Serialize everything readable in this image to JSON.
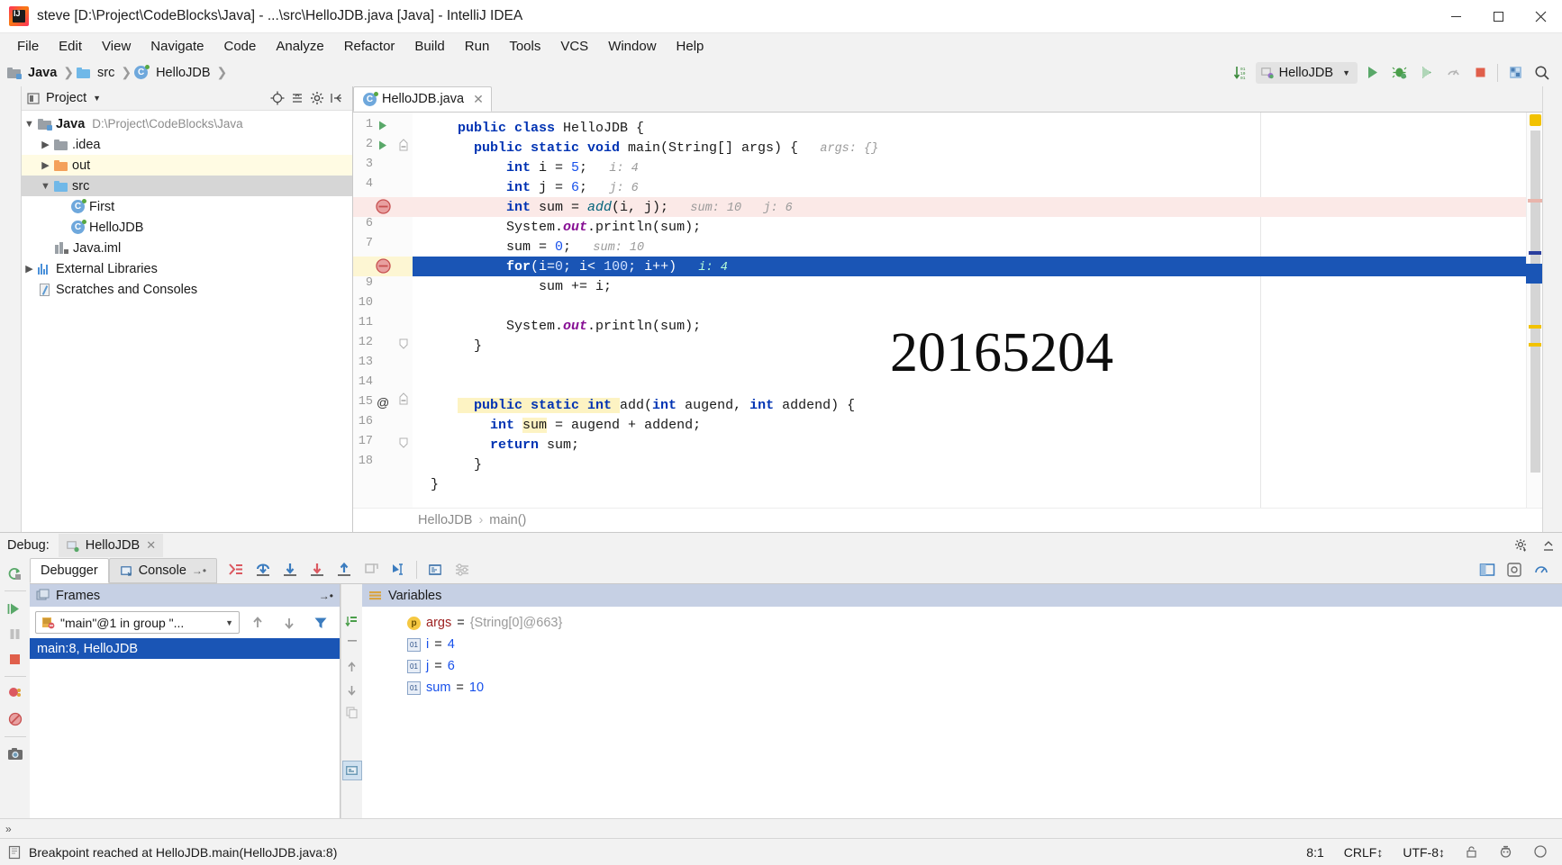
{
  "window": {
    "title": "steve [D:\\Project\\CodeBlocks\\Java] - ...\\src\\HelloJDB.java [Java] - IntelliJ IDEA",
    "minimize": "—",
    "maximize": "□",
    "close": "✕"
  },
  "menu": [
    "File",
    "Edit",
    "View",
    "Navigate",
    "Code",
    "Analyze",
    "Refactor",
    "Build",
    "Run",
    "Tools",
    "VCS",
    "Window",
    "Help"
  ],
  "breadcrumb_nav": [
    {
      "label": "Java",
      "icon": "module-icon",
      "bold": true
    },
    {
      "label": "src",
      "icon": "folder-blue-icon",
      "bold": false
    },
    {
      "label": "HelloJDB",
      "icon": "class-icon",
      "bold": false
    }
  ],
  "toolbar": {
    "run_config": "HelloJDB",
    "icons": [
      "sort-lines-icon",
      "run-icon",
      "debug-icon",
      "coverage-icon",
      "profiler-icon",
      "stop-icon",
      "build-project-icon",
      "search-everywhere-icon"
    ]
  },
  "project_panel": {
    "title": "Project",
    "header_icons": [
      "locate-icon",
      "collapse-all-icon",
      "gear-icon",
      "hide-icon"
    ],
    "tree": [
      {
        "indent": 0,
        "arrow": "down",
        "icon": "module-icon",
        "label": "Java",
        "bold": true,
        "path": "D:\\Project\\CodeBlocks\\Java",
        "highlight": "none"
      },
      {
        "indent": 1,
        "arrow": "right",
        "icon": "folder-grey-icon",
        "label": ".idea",
        "bold": false,
        "path": "",
        "highlight": "none"
      },
      {
        "indent": 1,
        "arrow": "right",
        "icon": "folder-orange-icon",
        "label": "out",
        "bold": false,
        "path": "",
        "highlight": "yellow"
      },
      {
        "indent": 1,
        "arrow": "down",
        "icon": "folder-blue-icon",
        "label": "src",
        "bold": false,
        "path": "",
        "highlight": "grey"
      },
      {
        "indent": 2,
        "arrow": "none",
        "icon": "class-icon",
        "label": "First",
        "bold": false,
        "path": "",
        "highlight": "none"
      },
      {
        "indent": 2,
        "arrow": "none",
        "icon": "class-icon",
        "label": "HelloJDB",
        "bold": false,
        "path": "",
        "highlight": "none"
      },
      {
        "indent": 1,
        "arrow": "none",
        "icon": "iml-file-icon",
        "label": "Java.iml",
        "bold": false,
        "path": "",
        "highlight": "none"
      },
      {
        "indent": 0,
        "arrow": "right",
        "icon": "library-icon",
        "label": "External Libraries",
        "bold": false,
        "path": "",
        "highlight": "none"
      },
      {
        "indent": 0,
        "arrow": "none",
        "icon": "scratch-icon",
        "label": "Scratches and Consoles",
        "bold": false,
        "path": "",
        "highlight": "none"
      }
    ]
  },
  "editor": {
    "tab": {
      "label": "HelloJDB.java",
      "icon": "java-class-icon",
      "close": "✕"
    },
    "watermark": "20165204",
    "breadcrumb": {
      "class": "HelloJDB",
      "sep": "›",
      "method": "main()"
    },
    "lines": [
      {
        "n": 1,
        "gutter": "run-arrow",
        "state": "normal",
        "tokens": [
          {
            "t": "    ",
            "c": "plain"
          },
          {
            "t": "public class ",
            "c": "kw"
          },
          {
            "t": "HelloJDB {",
            "c": "plain"
          }
        ]
      },
      {
        "n": 2,
        "gutter": "run-arrow-fold",
        "state": "normal",
        "tokens": [
          {
            "t": "    ",
            "c": "plain"
          },
          {
            "t": "public static void ",
            "c": "kw"
          },
          {
            "t": "main(String[] args) {",
            "c": "plain"
          },
          {
            "t": "   args: {}",
            "c": "hint"
          }
        ]
      },
      {
        "n": 3,
        "gutter": "",
        "state": "normal",
        "tokens": [
          {
            "t": "        ",
            "c": "plain"
          },
          {
            "t": "int",
            "c": "kw"
          },
          {
            "t": " i = ",
            "c": "plain"
          },
          {
            "t": "5",
            "c": "num"
          },
          {
            "t": ";",
            "c": "plain"
          },
          {
            "t": "   i: 4",
            "c": "hint"
          }
        ]
      },
      {
        "n": 4,
        "gutter": "",
        "state": "normal",
        "tokens": [
          {
            "t": "        ",
            "c": "plain"
          },
          {
            "t": "int",
            "c": "kw"
          },
          {
            "t": " j = ",
            "c": "plain"
          },
          {
            "t": "6",
            "c": "num"
          },
          {
            "t": ";",
            "c": "plain"
          },
          {
            "t": "   j: 6",
            "c": "hint"
          }
        ]
      },
      {
        "n": 5,
        "gutter": "breakpoint-disabled",
        "state": "error",
        "tokens": [
          {
            "t": "        ",
            "c": "plain"
          },
          {
            "t": "int",
            "c": "kw"
          },
          {
            "t": " sum = ",
            "c": "plain"
          },
          {
            "t": "add",
            "c": "mth"
          },
          {
            "t": "(i, j);",
            "c": "plain"
          },
          {
            "t": "   sum: 10   j: 6",
            "c": "hint"
          }
        ]
      },
      {
        "n": 6,
        "gutter": "",
        "state": "normal",
        "tokens": [
          {
            "t": "        ",
            "c": "plain"
          },
          {
            "t": "System.",
            "c": "plain"
          },
          {
            "t": "out",
            "c": "fld"
          },
          {
            "t": ".println(sum);",
            "c": "plain"
          }
        ]
      },
      {
        "n": 7,
        "gutter": "",
        "state": "normal",
        "tokens": [
          {
            "t": "        ",
            "c": "plain"
          },
          {
            "t": "sum = ",
            "c": "plain"
          },
          {
            "t": "0",
            "c": "num"
          },
          {
            "t": ";",
            "c": "plain"
          },
          {
            "t": "   sum: 10",
            "c": "hint"
          }
        ]
      },
      {
        "n": 8,
        "gutter": "breakpoint-disabled-bulb",
        "state": "current",
        "tokens": [
          {
            "t": "        ",
            "c": "plain"
          },
          {
            "t": "for",
            "c": "kw"
          },
          {
            "t": "(i=",
            "c": "plain"
          },
          {
            "t": "0",
            "c": "num"
          },
          {
            "t": "; i< ",
            "c": "plain"
          },
          {
            "t": "100",
            "c": "num"
          },
          {
            "t": "; i++)",
            "c": "plain"
          },
          {
            "t": "   i: 4",
            "c": "hint"
          }
        ]
      },
      {
        "n": 9,
        "gutter": "",
        "state": "normal",
        "tokens": [
          {
            "t": "            ",
            "c": "plain"
          },
          {
            "t": "sum += i;",
            "c": "plain"
          }
        ]
      },
      {
        "n": 10,
        "gutter": "",
        "state": "normal",
        "tokens": []
      },
      {
        "n": 11,
        "gutter": "",
        "state": "normal",
        "tokens": [
          {
            "t": "        ",
            "c": "plain"
          },
          {
            "t": "System.",
            "c": "plain"
          },
          {
            "t": "out",
            "c": "fld"
          },
          {
            "t": ".println(sum);",
            "c": "plain"
          }
        ]
      },
      {
        "n": 12,
        "gutter": "fold-end",
        "state": "normal",
        "tokens": [
          {
            "t": "    ",
            "c": "plain"
          },
          {
            "t": "}",
            "c": "plain"
          }
        ]
      },
      {
        "n": 13,
        "gutter": "",
        "state": "normal",
        "tokens": []
      },
      {
        "n": 14,
        "gutter": "at-fold",
        "state": "normal",
        "tokens": [
          {
            "t": "    ",
            "c": "plain"
          },
          {
            "t": "public static int ",
            "c": "kw-hl"
          },
          {
            "t": "add(",
            "c": "plain"
          },
          {
            "t": "int",
            "c": "kw"
          },
          {
            "t": " augend, ",
            "c": "plain"
          },
          {
            "t": "int",
            "c": "kw"
          },
          {
            "t": " addend) {",
            "c": "plain"
          }
        ]
      },
      {
        "n": 15,
        "gutter": "",
        "state": "normal",
        "tokens": [
          {
            "t": "      ",
            "c": "plain"
          },
          {
            "t": "int",
            "c": "kw"
          },
          {
            "t": " ",
            "c": "plain"
          },
          {
            "t": "sum",
            "c": "hl"
          },
          {
            "t": " = augend + addend;",
            "c": "plain"
          }
        ]
      },
      {
        "n": 16,
        "gutter": "",
        "state": "normal",
        "tokens": [
          {
            "t": "      ",
            "c": "plain"
          },
          {
            "t": "return",
            "c": "kw"
          },
          {
            "t": " sum;",
            "c": "plain"
          }
        ]
      },
      {
        "n": 17,
        "gutter": "fold-end",
        "state": "normal",
        "tokens": [
          {
            "t": "    ",
            "c": "plain"
          },
          {
            "t": "}",
            "c": "plain"
          }
        ]
      },
      {
        "n": 18,
        "gutter": "",
        "state": "normal",
        "tokens": [
          {
            "t": "}",
            "c": "plain"
          }
        ]
      }
    ]
  },
  "debug": {
    "label": "Debug:",
    "session_tab": {
      "label": "HelloJDB",
      "icon": "debug-session-icon",
      "close": "✕"
    },
    "tabs": [
      {
        "label": "Debugger",
        "active": true,
        "icon": ""
      },
      {
        "label": "Console",
        "active": false,
        "icon": "console-icon",
        "suffix": "→•"
      }
    ],
    "step_icons": [
      "show-execution-point-icon",
      "step-over-icon",
      "step-into-icon",
      "force-step-into-icon",
      "step-out-icon",
      "drop-frame-icon",
      "run-to-cursor-icon",
      "evaluate-expression-icon",
      "settings-icon"
    ],
    "right_icons": [
      "layout-icon",
      "mute-breakpoints-icon",
      "settings-gear-icon"
    ],
    "frames": {
      "title": "Frames",
      "thread": "\"main\"@1 in group \"...",
      "items": [
        {
          "label": "main:8, HelloJDB",
          "selected": true
        }
      ]
    },
    "variables": {
      "title": "Variables",
      "items": [
        {
          "badge": "p",
          "badge_type": "param",
          "name": "args",
          "value": "{String[0]@663}",
          "name_color": "red",
          "value_color": "grey"
        },
        {
          "badge": "01",
          "badge_type": "primitive",
          "name": "i",
          "value": "4",
          "name_color": "blue",
          "value_color": "blue"
        },
        {
          "badge": "01",
          "badge_type": "primitive",
          "name": "j",
          "value": "6",
          "name_color": "blue",
          "value_color": "blue"
        },
        {
          "badge": "01",
          "badge_type": "primitive",
          "name": "sum",
          "value": "10",
          "name_color": "blue",
          "value_color": "blue"
        }
      ]
    },
    "left_actions": [
      "rerun-icon",
      "resume-program-icon",
      "pause-program-icon",
      "stop-icon",
      "view-breakpoints-icon",
      "mute-breakpoints-icon",
      "camera-icon"
    ]
  },
  "statusbar": {
    "message": "Breakpoint reached at HelloJDB.main(HelloJDB.java:8)",
    "caret": "8:1",
    "line_sep": "CRLF↕",
    "encoding": "UTF-8↕",
    "lock": "lock-icon",
    "inspection": "inspection-icon",
    "search": "search-icon"
  }
}
